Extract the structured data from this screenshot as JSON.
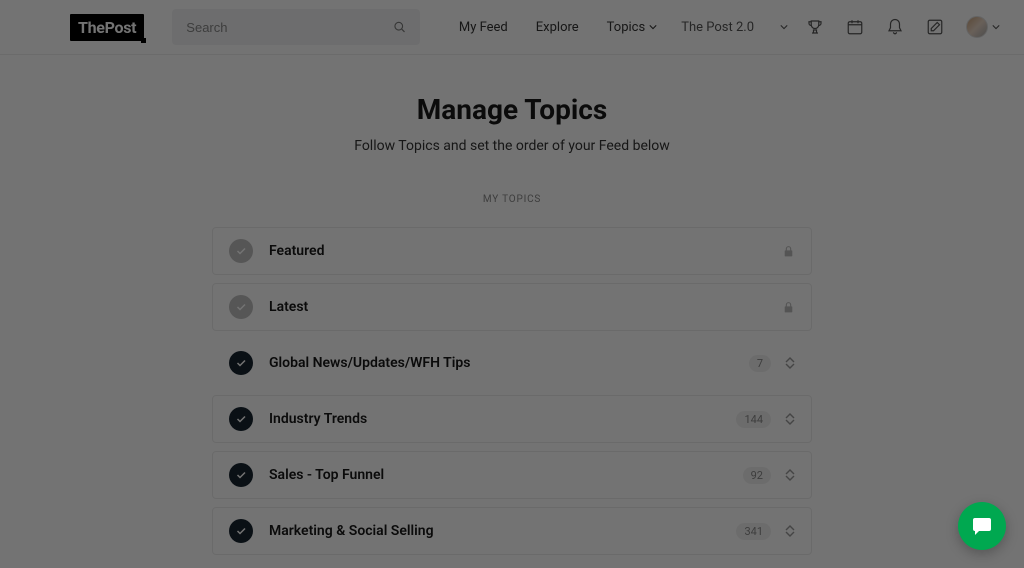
{
  "header": {
    "logo": "ThePost",
    "search_placeholder": "Search",
    "nav": {
      "feed": "My Feed",
      "explore": "Explore",
      "topics": "Topics"
    },
    "workspace_name": "The Post 2.0"
  },
  "page": {
    "title": "Manage Topics",
    "subtitle": "Follow Topics and set the order of your Feed below",
    "section_label": "MY TOPICS"
  },
  "topics": [
    {
      "name": "Featured",
      "locked": true,
      "count": null
    },
    {
      "name": "Latest",
      "locked": true,
      "count": null
    },
    {
      "name": "Global News/Updates/WFH Tips",
      "locked": false,
      "count": "7",
      "highlight": true
    },
    {
      "name": "Industry Trends",
      "locked": false,
      "count": "144"
    },
    {
      "name": "Sales - Top Funnel",
      "locked": false,
      "count": "92"
    },
    {
      "name": "Marketing & Social Selling",
      "locked": false,
      "count": "341"
    }
  ]
}
